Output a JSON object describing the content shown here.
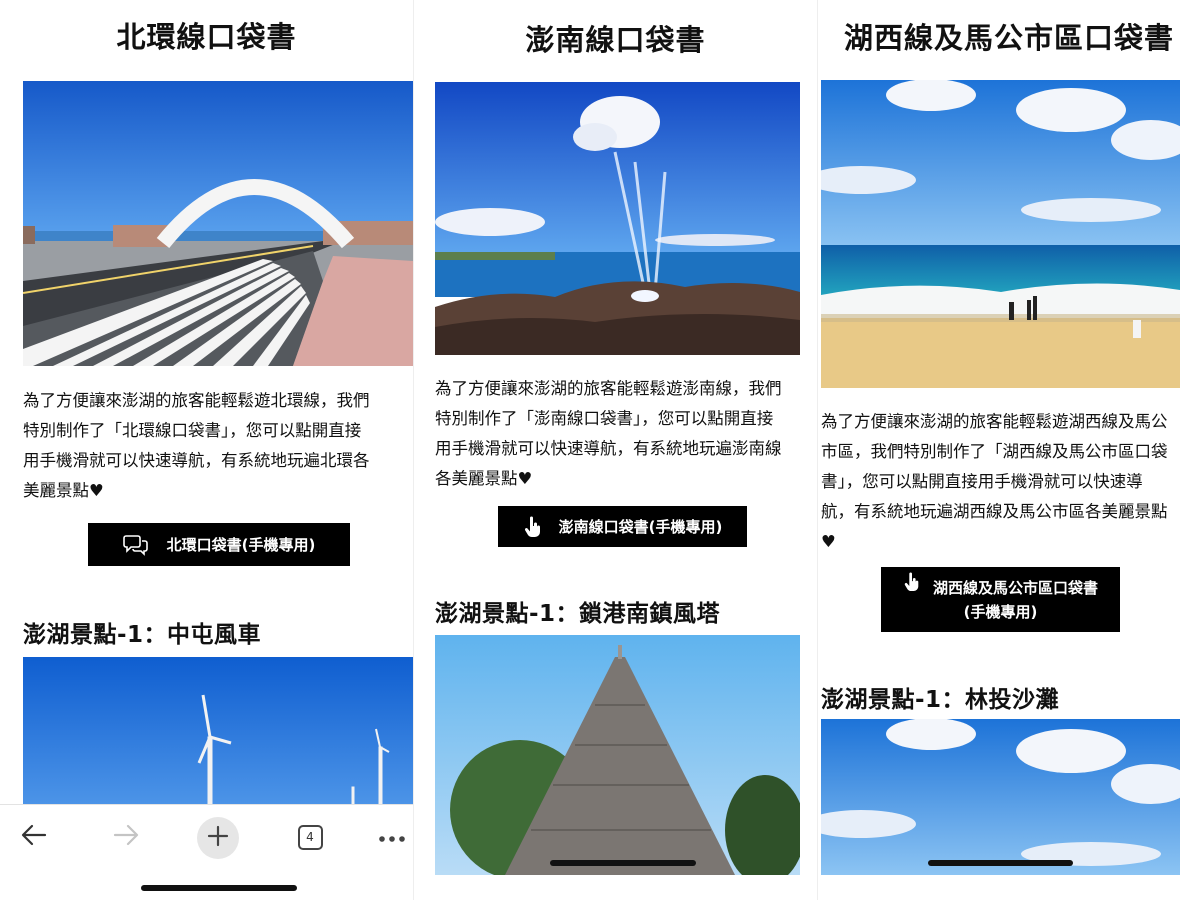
{
  "panels": {
    "north": {
      "title": "北環線口袋書",
      "desc_lines": [
        "為了方便讓來澎湖的旅客能輕鬆遊北環線，我們",
        "特別制作了「北環線口袋書」，您可以點開直接",
        "用手機滑就可以快速導航，有系統地玩遍北環各",
        "美麗景點♥"
      ],
      "button_label": "北環口袋書(手機專用)",
      "button_icon": "chat-bubbles-icon",
      "spot_heading": "澎湖景點-1：中屯風車"
    },
    "south": {
      "title": "澎南線口袋書",
      "desc_lines": [
        "為了方便讓來澎湖的旅客能輕鬆遊澎南線，我們",
        "特別制作了「澎南線口袋書」，您可以點開直接",
        "用手機滑就可以快速導航，有系統地玩遍澎南線",
        "各美麗景點♥"
      ],
      "button_label": "澎南線口袋書(手機專用)",
      "button_icon": "pointing-hand-icon",
      "spot_heading": "澎湖景點-1：鎖港南鎮風塔"
    },
    "west": {
      "title": "湖西線及馬公市區口袋書",
      "desc_lines": [
        "為了方便讓來澎湖的旅客能輕鬆遊湖西線及馬公",
        "市區，我們特別制作了「湖西線及馬公市區口袋",
        "書」，您可以點開直接用手機滑就可以快速導",
        "航，有系統地玩遍湖西線及馬公市區各美麗景點",
        "♥"
      ],
      "button_label_1": "湖西線及馬公市區口袋書",
      "button_label_2": "(手機專用)",
      "button_icon": "pointing-hand-icon",
      "spot_heading": "澎湖景點-1：林投沙灘"
    }
  },
  "browser_toolbar": {
    "back_icon": "back-arrow-icon",
    "forward_icon": "forward-arrow-icon",
    "new_tab_icon": "plus-icon",
    "tab_count": "4",
    "more_icon": "more-dots-icon"
  },
  "colors": {
    "button_bg": "#000000",
    "sky_blue": "#1f6fd6",
    "text": "#111111"
  }
}
